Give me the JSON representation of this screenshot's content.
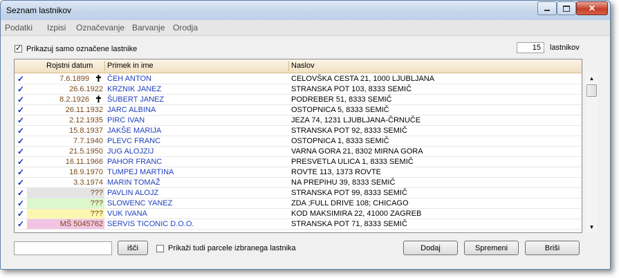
{
  "window": {
    "title": "Seznam lastnikov"
  },
  "menu": [
    "Podatki",
    "Izpisi",
    "Označevanje",
    "Barvanje",
    "Orodja"
  ],
  "filter": {
    "show_marked_label": "Prikazuj samo označene lastnike",
    "show_marked_checked": true
  },
  "count": {
    "value": "15",
    "unit": "lastnikov"
  },
  "columns": {
    "date": "Rojstni datum",
    "name": "Primek in ime",
    "address": "Naslov"
  },
  "rows": [
    {
      "date": "7.6.1899",
      "deceased": true,
      "name": "ČEH ANTON",
      "address": "CELOVŠKA CESTA 21, 1000 LJUBLJANA",
      "bg": ""
    },
    {
      "date": "26.6.1922",
      "deceased": false,
      "name": "KRZNIK JANEZ",
      "address": "STRANSKA POT 103, 8333 SEMIČ",
      "bg": ""
    },
    {
      "date": "8.2.1926",
      "deceased": true,
      "name": "ŠUBERT JANEZ",
      "address": "PODREBER 51, 8333 SEMIČ",
      "bg": ""
    },
    {
      "date": "26.11.1932",
      "deceased": false,
      "name": "JARC ALBINA",
      "address": "OSTOPNICA 5, 8333 SEMIČ",
      "bg": ""
    },
    {
      "date": "2.12.1935",
      "deceased": false,
      "name": "PIRC IVAN",
      "address": "JEZA 74, 1231 LJUBLJANA-ČRNUČE",
      "bg": ""
    },
    {
      "date": "15.8.1937",
      "deceased": false,
      "name": "JAKŠE MARIJA",
      "address": "STRANSKA POT 92, 8333 SEMIČ",
      "bg": ""
    },
    {
      "date": "7.7.1940",
      "deceased": false,
      "name": "PLEVC FRANC",
      "address": "OSTOPNICA 1, 8333 SEMIČ",
      "bg": ""
    },
    {
      "date": "21.5.1950",
      "deceased": false,
      "name": "JUG ALOJZIJ",
      "address": "VARNA GORA 21, 8302 MIRNA GORA",
      "bg": ""
    },
    {
      "date": "16.11.1966",
      "deceased": false,
      "name": "PAHOR FRANC",
      "address": "PRESVETLA ULICA 1, 8333 SEMIČ",
      "bg": ""
    },
    {
      "date": "18.9.1970",
      "deceased": false,
      "name": "TUMPEJ MARTINA",
      "address": "ROVTE 113, 1373 ROVTE",
      "bg": ""
    },
    {
      "date": "3.3.1974",
      "deceased": false,
      "name": "MARIN TOMAŽ",
      "address": "NA PREPIHU 39, 8333 SEMIČ",
      "bg": ""
    },
    {
      "date": "???",
      "deceased": false,
      "name": "PAVLIN ALOJZ",
      "address": "STRANSKA POT 99, 8333 SEMIČ",
      "bg": "#e4e4e4"
    },
    {
      "date": "???",
      "deceased": false,
      "name": "SLOWENC YANEZ",
      "address": "ZDA ;FULL DRIVE 108; CHICAGO",
      "bg": "#dcf7cc"
    },
    {
      "date": "???",
      "deceased": false,
      "name": "VUK IVANA",
      "address": "KOD MAKSIMIRA 22, 41000 ZAGREB",
      "bg": "#fbf7b0"
    },
    {
      "date": "MŠ 5045762",
      "deceased": false,
      "name": "SERVIS TICONIC D.O.O.",
      "address": "STRANSKA POT 71, 8333 SEMIČ",
      "bg": "#f3c4e2"
    }
  ],
  "search": {
    "value": "",
    "button": "išči"
  },
  "parcels": {
    "label": "Prikaži tudi parcele izbranega lastnika",
    "checked": false
  },
  "buttons": {
    "add": "Dodaj",
    "edit": "Spremeni",
    "delete": "Briši"
  },
  "colors": {
    "name_text": "#1f3fbf",
    "check_mark": "#1030c0",
    "date_text": "#7a4a1a"
  }
}
